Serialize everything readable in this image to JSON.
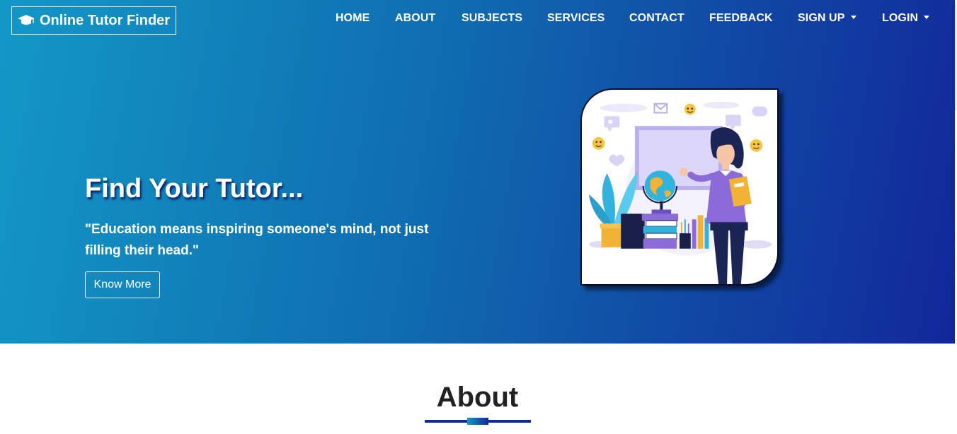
{
  "brand": {
    "name": "Online Tutor Finder",
    "icon": "graduation-cap-icon"
  },
  "nav": {
    "items": [
      {
        "label": "HOME"
      },
      {
        "label": "ABOUT"
      },
      {
        "label": "SUBJECTS"
      },
      {
        "label": "SERVICES"
      },
      {
        "label": "CONTACT"
      },
      {
        "label": "FEEDBACK"
      },
      {
        "label": "SIGN UP",
        "dropdown": true
      },
      {
        "label": "LOGIN",
        "dropdown": true
      }
    ]
  },
  "hero": {
    "title": "Find Your Tutor...",
    "quote": "\"Education means inspiring someone's mind, not just filling their head.\"",
    "button_label": "Know More",
    "illustration": "teacher-illustration"
  },
  "about": {
    "title": "About"
  },
  "colors": {
    "gradient_start": "#1398c6",
    "gradient_end": "#12279a",
    "text_on_hero": "#ffffff",
    "about_rule": "#10289a"
  }
}
